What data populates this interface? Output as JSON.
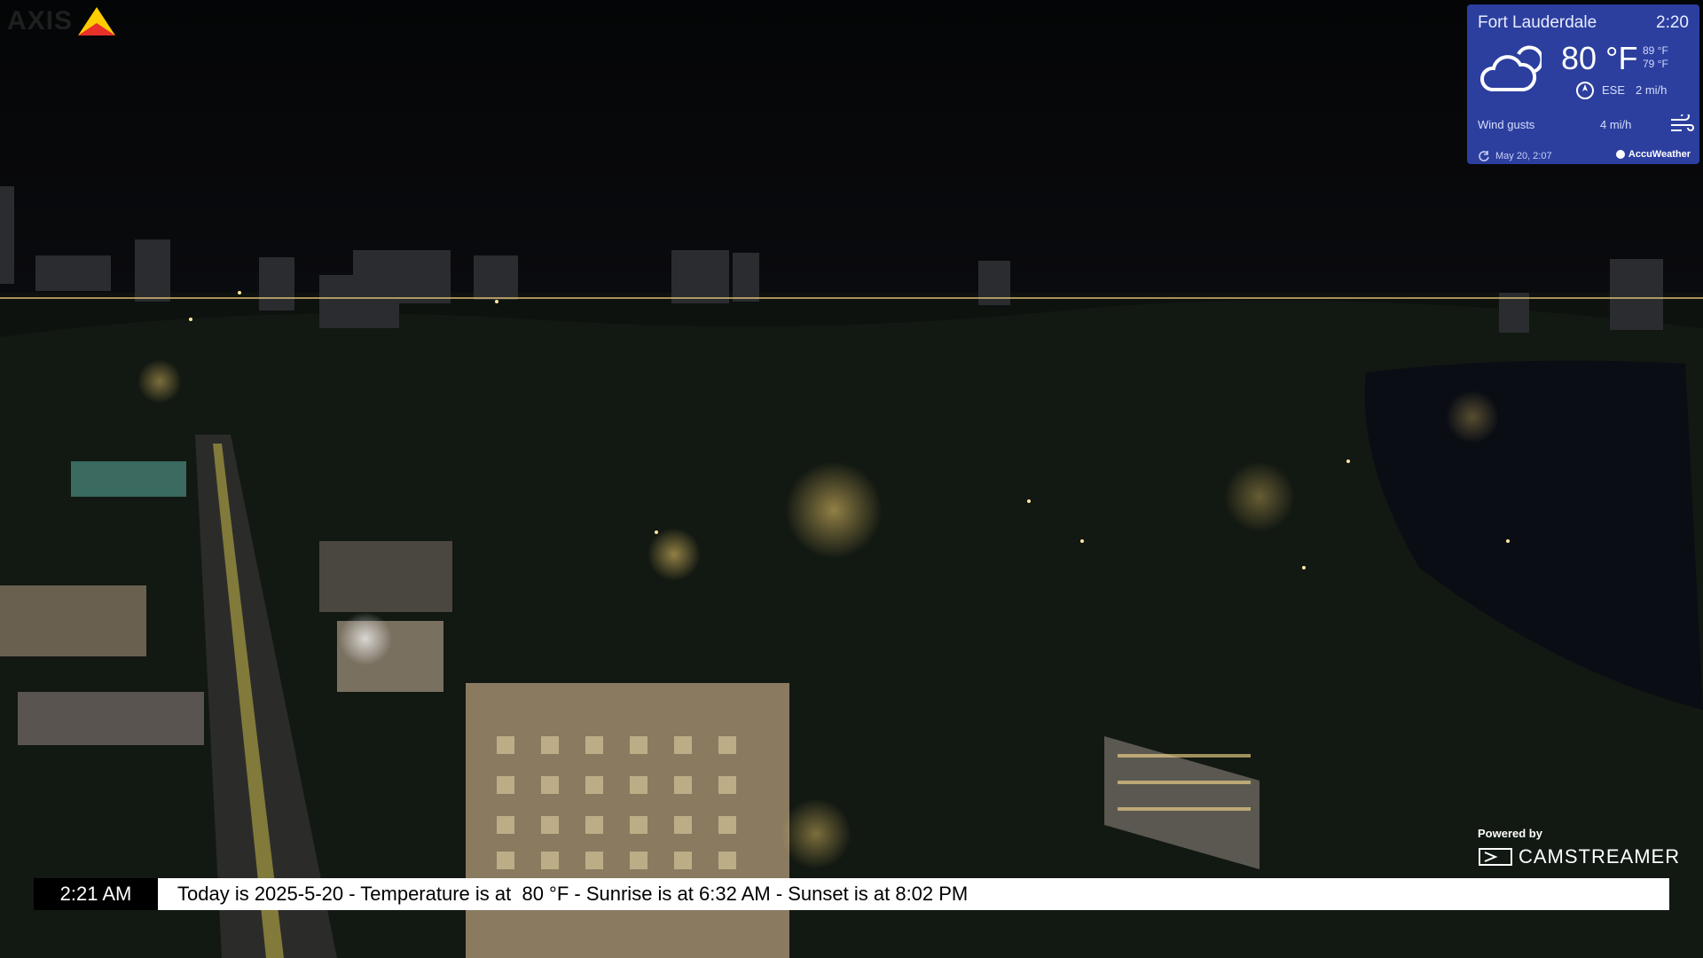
{
  "logo": {
    "text": "AXIS"
  },
  "weather": {
    "city": "Fort Lauderdale",
    "time": "2:20",
    "temperature": "80 °F",
    "high": "89 °F",
    "low": "79 °F",
    "wind_direction": "ESE",
    "wind_speed": "2 mi/h",
    "gusts_label": "Wind gusts",
    "gusts_value": "4 mi/h",
    "updated": "May 20, 2:07",
    "brand": "AccuWeather",
    "condition_icon": "partly-cloudy-night-icon",
    "bg_color": "#2c3f9e"
  },
  "powered": {
    "label": "Powered by",
    "brand": "CAMSTREAMER"
  },
  "ticker": {
    "time": "2:21 AM",
    "message": "Today is 2025-5-20 - Temperature is at  80 °F - Sunrise is at 6:32 AM - Sunset is at 8:02 PM"
  }
}
